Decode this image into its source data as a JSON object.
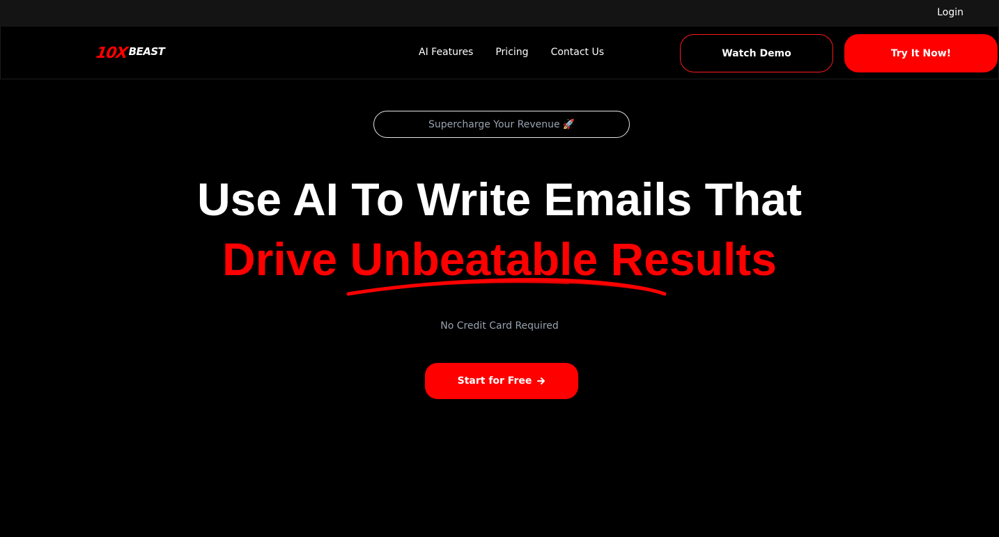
{
  "topbar": {
    "login_label": "Login"
  },
  "navbar": {
    "logo": {
      "part1": "10X",
      "part2": "BEAST"
    },
    "links": [
      {
        "label": "AI Features"
      },
      {
        "label": "Pricing"
      },
      {
        "label": "Contact Us"
      }
    ],
    "watch_demo_label": "Watch Demo",
    "try_now_label": "Try It Now!"
  },
  "hero": {
    "badge_text": "Supercharge Your Revenue",
    "badge_icon": "rocket-icon",
    "headline_line1": "Use AI To Write Emails That",
    "headline_line2": "Drive Unbeatable Results",
    "subtext": "No Credit Card Required",
    "cta_label": "Start for Free",
    "cta_icon": "arrow-right-icon"
  },
  "colors": {
    "accent": "#ff0000",
    "background": "#000000",
    "topbar": "#141414",
    "muted_text": "#9aa3b0"
  }
}
